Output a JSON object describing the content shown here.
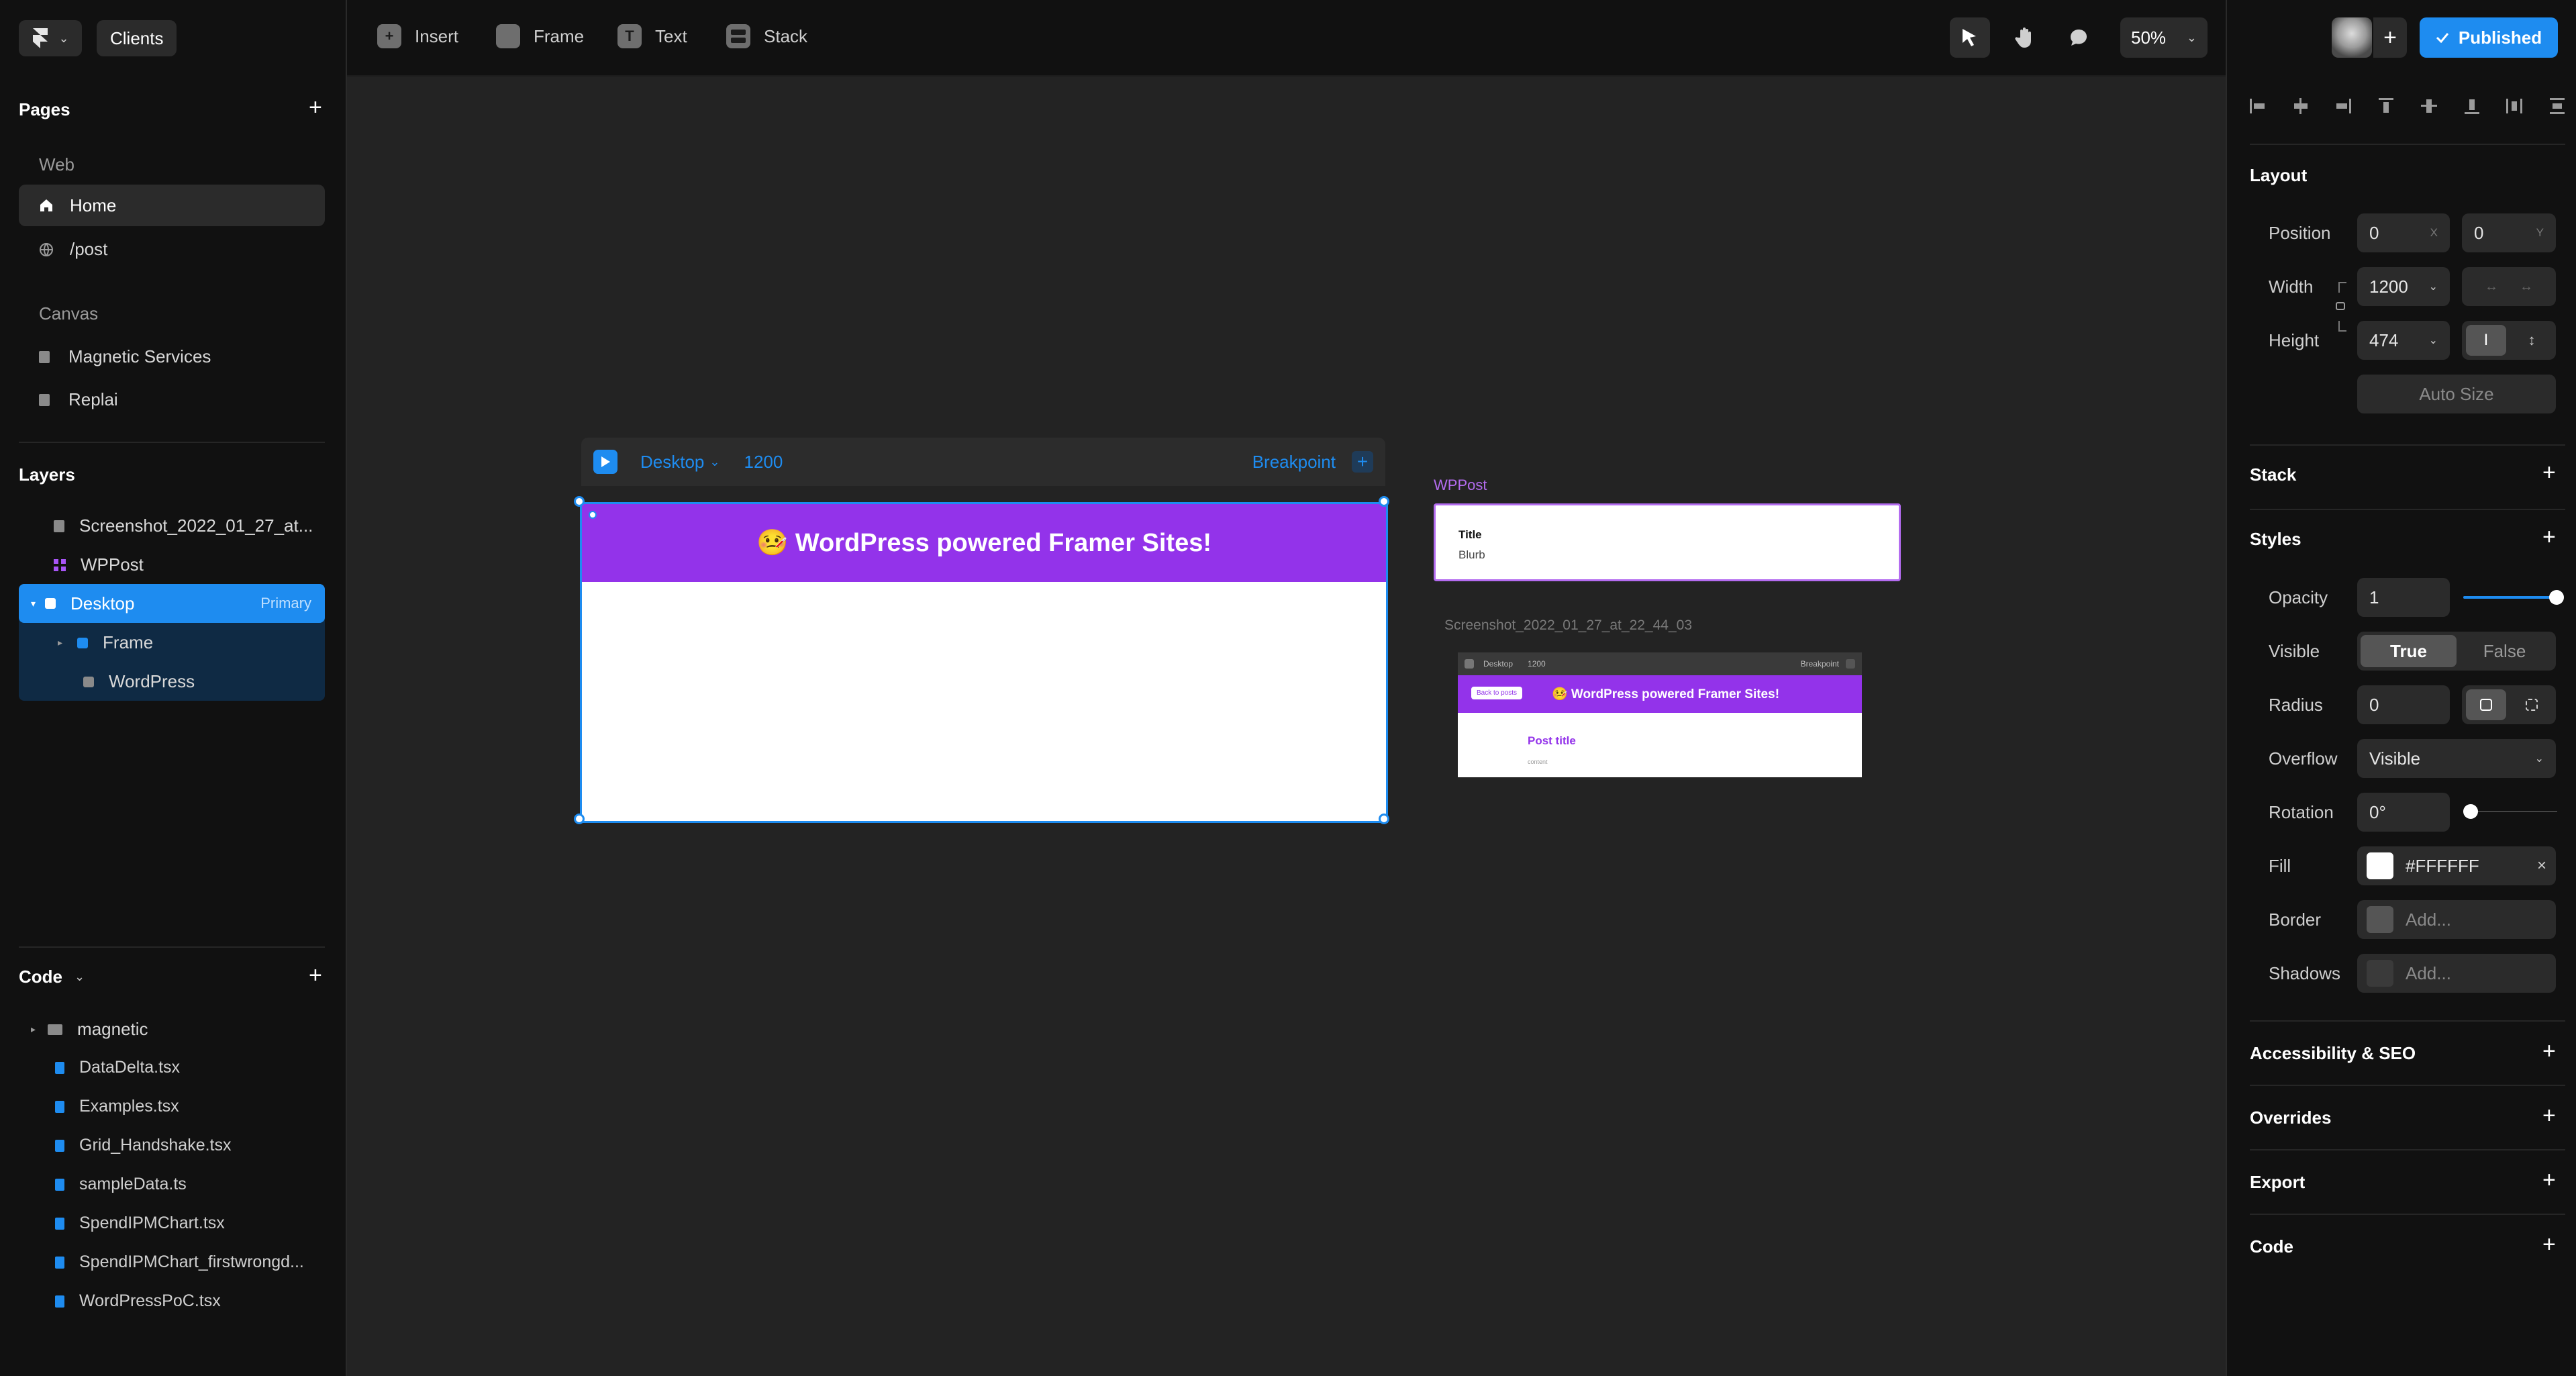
{
  "topbar": {
    "clients_label": "Clients",
    "tools": [
      {
        "label": "Insert",
        "icon": "plus-icon"
      },
      {
        "label": "Frame",
        "icon": "frame-icon"
      },
      {
        "label": "Text",
        "icon": "text-icon"
      },
      {
        "label": "Stack",
        "icon": "stack-icon"
      }
    ],
    "zoom": "50%",
    "publish_label": "Published"
  },
  "pages": {
    "title": "Pages",
    "group_web": "Web",
    "home": "Home",
    "post": "/post",
    "group_canvas": "Canvas",
    "magnetic": "Magnetic Services",
    "replai": "Replai"
  },
  "layers": {
    "title": "Layers",
    "items": [
      "Screenshot_2022_01_27_at...",
      "WPPost",
      "Desktop",
      "Frame",
      "WordPress"
    ],
    "primary_badge": "Primary"
  },
  "code": {
    "title": "Code",
    "folder": "magnetic",
    "files": [
      "DataDelta.tsx",
      "Examples.tsx",
      "Grid_Handshake.tsx",
      "sampleData.ts",
      "SpendIPMChart.tsx",
      "SpendIPMChart_firstwrongd...",
      "WordPressPoC.tsx"
    ]
  },
  "canvas": {
    "breakpoint_name": "Desktop",
    "breakpoint_width": "1200",
    "breakpoint_label": "Breakpoint",
    "banner_text": "🤒 WordPress powered Framer Sites!",
    "wppost_label": "WPPost",
    "wppost_title": "Title",
    "wppost_blurb": "Blurb",
    "screenshot_label": "Screenshot_2022_01_27_at_22_44_03",
    "thumb_device": "Desktop",
    "thumb_width": "1200",
    "thumb_breakpoint": "Breakpoint",
    "thumb_back": "Back to posts",
    "thumb_banner": "🤒 WordPress powered Framer Sites!",
    "thumb_post_title": "Post title",
    "thumb_content": "content"
  },
  "props": {
    "layout_title": "Layout",
    "position_label": "Position",
    "x_value": "0",
    "x_suffix": "X",
    "y_value": "0",
    "y_suffix": "Y",
    "width_label": "Width",
    "width_value": "1200",
    "height_label": "Height",
    "height_value": "474",
    "auto_size": "Auto Size",
    "stack_title": "Stack",
    "styles_title": "Styles",
    "opacity_label": "Opacity",
    "opacity_value": "1",
    "opacity_level": 1,
    "visible_label": "Visible",
    "visible_true": "True",
    "visible_false": "False",
    "radius_label": "Radius",
    "radius_value": "0",
    "overflow_label": "Overflow",
    "overflow_value": "Visible",
    "rotation_label": "Rotation",
    "rotation_value": "0°",
    "fill_label": "Fill",
    "fill_value": "#FFFFFF",
    "border_label": "Border",
    "border_placeholder": "Add...",
    "shadows_label": "Shadows",
    "shadows_placeholder": "Add...",
    "sections": [
      "Accessibility & SEO",
      "Overrides",
      "Export",
      "Code"
    ]
  },
  "colors": {
    "accent": "#1e8cf0",
    "banner": "#9333ea",
    "wppost_accent": "#b46cf0"
  }
}
